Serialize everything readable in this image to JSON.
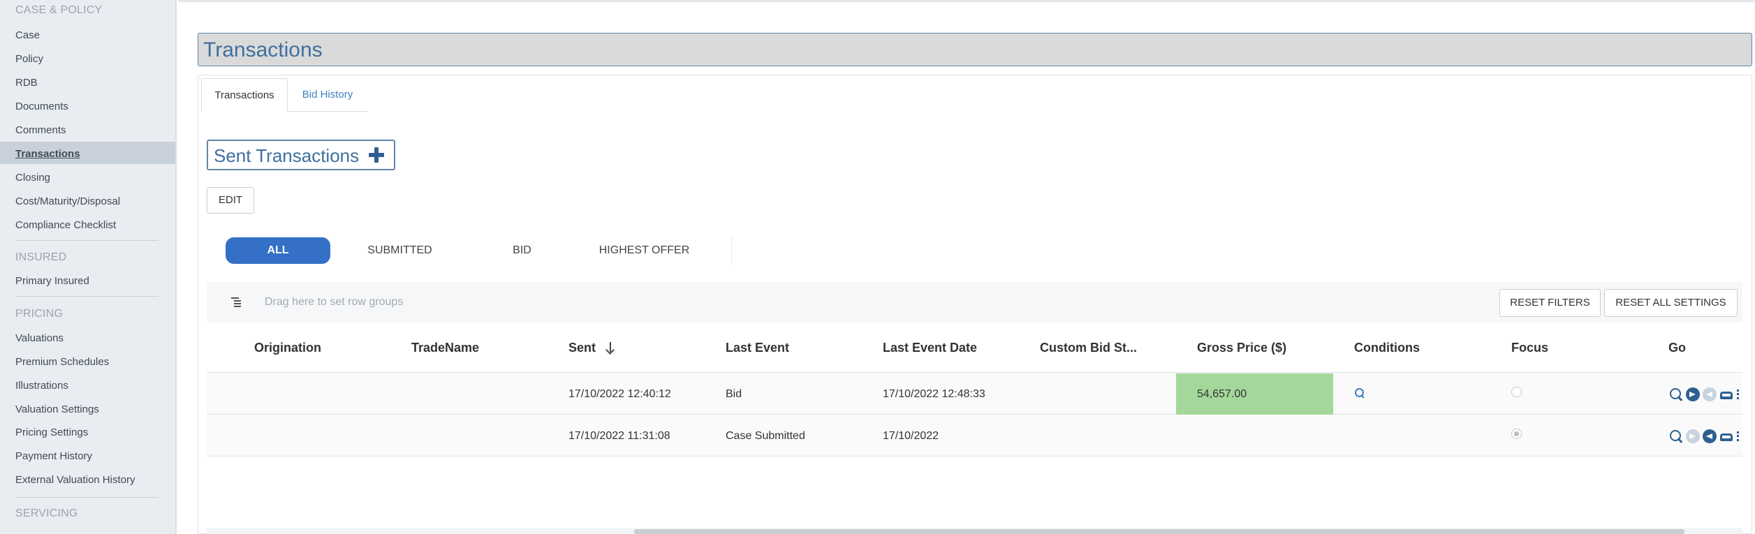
{
  "sidebar": {
    "sections": [
      {
        "header": "CASE & POLICY",
        "items": [
          "Case",
          "Policy",
          "RDB",
          "Documents",
          "Comments",
          "Transactions",
          "Closing",
          "Cost/Maturity/Disposal",
          "Compliance Checklist"
        ]
      },
      {
        "header": "INSURED",
        "items": [
          "Primary Insured"
        ]
      },
      {
        "header": "PRICING",
        "items": [
          "Valuations",
          "Premium Schedules",
          "Illustrations",
          "Valuation Settings",
          "Pricing Settings",
          "Payment History",
          "External Valuation History"
        ]
      },
      {
        "header": "SERVICING",
        "items": []
      }
    ],
    "active_item": "Transactions"
  },
  "page": {
    "title": "Transactions"
  },
  "tabs": [
    {
      "label": "Transactions",
      "active": true
    },
    {
      "label": "Bid History",
      "active": false
    }
  ],
  "section": {
    "title": "Sent Transactions",
    "add_icon": "plus-icon",
    "edit_label": "EDIT"
  },
  "filters": [
    "ALL",
    "SUBMITTED",
    "BID",
    "HIGHEST OFFER"
  ],
  "active_filter": "ALL",
  "grid": {
    "row_group_placeholder": "Drag here to set row groups",
    "reset_filters_label": "RESET FILTERS",
    "reset_all_label": "RESET ALL SETTINGS",
    "columns": [
      "Origination",
      "TradeName",
      "Sent",
      "Last Event",
      "Last Event Date",
      "Custom Bid St...",
      "Gross Price ($)",
      "Conditions",
      "Focus",
      "Go"
    ],
    "sorted_column": "Sent",
    "sort_direction": "descending",
    "rows": [
      {
        "origination": "",
        "trade_name": "",
        "sent": "17/10/2022 12:40:12",
        "last_event": "Bid",
        "last_event_date": "17/10/2022 12:48:33",
        "custom_bid_status": "",
        "gross_price": "54,657.00",
        "has_conditions": true,
        "focus": false
      },
      {
        "origination": "",
        "trade_name": "",
        "sent": "17/10/2022 11:31:08",
        "last_event": "Case Submitted",
        "last_event_date": "17/10/2022",
        "custom_bid_status": "",
        "gross_price": "",
        "has_conditions": false,
        "focus": true
      }
    ]
  },
  "colors": {
    "accent": "#3470c6",
    "title_text": "#3f6f9f",
    "price_highlight": "#a3d89a",
    "sidebar_bg": "#e9edf1"
  }
}
